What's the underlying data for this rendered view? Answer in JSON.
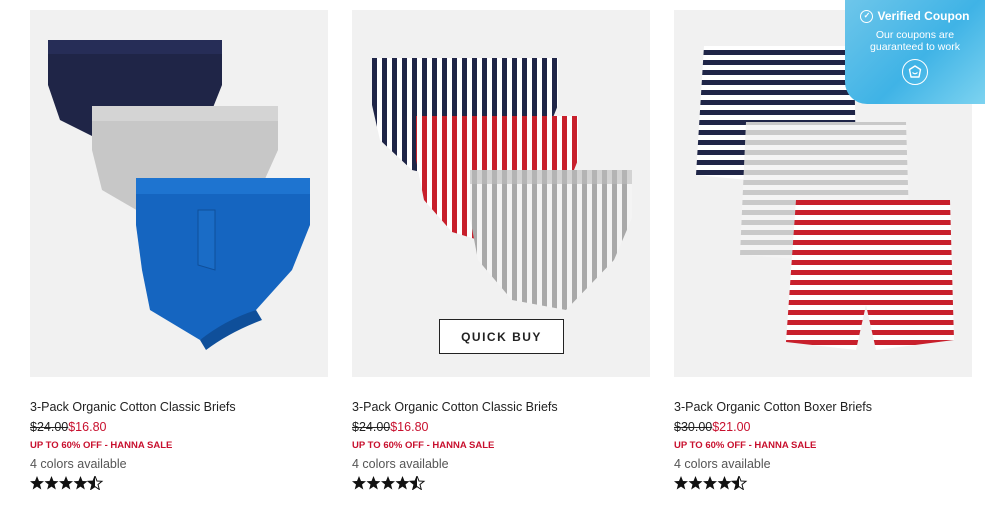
{
  "products": [
    {
      "title": "3-Pack Organic Cotton Classic Briefs",
      "original_price": "$24.00",
      "sale_price": "$16.80",
      "promo": "UP TO 60% OFF - HANNA SALE",
      "colors_available": "4 colors available",
      "rating": 4.5,
      "image": "solid-briefs-navy-grey-blue"
    },
    {
      "title": "3-Pack Organic Cotton Classic Briefs",
      "original_price": "$24.00",
      "sale_price": "$16.80",
      "promo": "UP TO 60% OFF - HANNA SALE",
      "colors_available": "4 colors available",
      "rating": 4.5,
      "image": "striped-briefs-navy-red-grey",
      "quick_buy_label": "QUICK BUY"
    },
    {
      "title": "3-Pack Organic Cotton Boxer Briefs",
      "original_price": "$30.00",
      "sale_price": "$21.00",
      "promo": "UP TO 60% OFF - HANNA SALE",
      "colors_available": "4 colors available",
      "rating": 4.5,
      "image": "striped-boxers-navy-grey-red"
    }
  ],
  "coupon": {
    "title": "Verified Coupon",
    "subtitle_line1": "Our coupons are",
    "subtitle_line2": "guaranteed to work",
    "icon": "shield-logo-icon"
  },
  "colors": {
    "sale_red": "#c8102e",
    "coupon_blue": "#3fb3e6",
    "navy": "#1f2547",
    "royal_blue": "#1565c0",
    "heather_grey": "#c9c9c9",
    "stripe_red": "#c8202c"
  }
}
